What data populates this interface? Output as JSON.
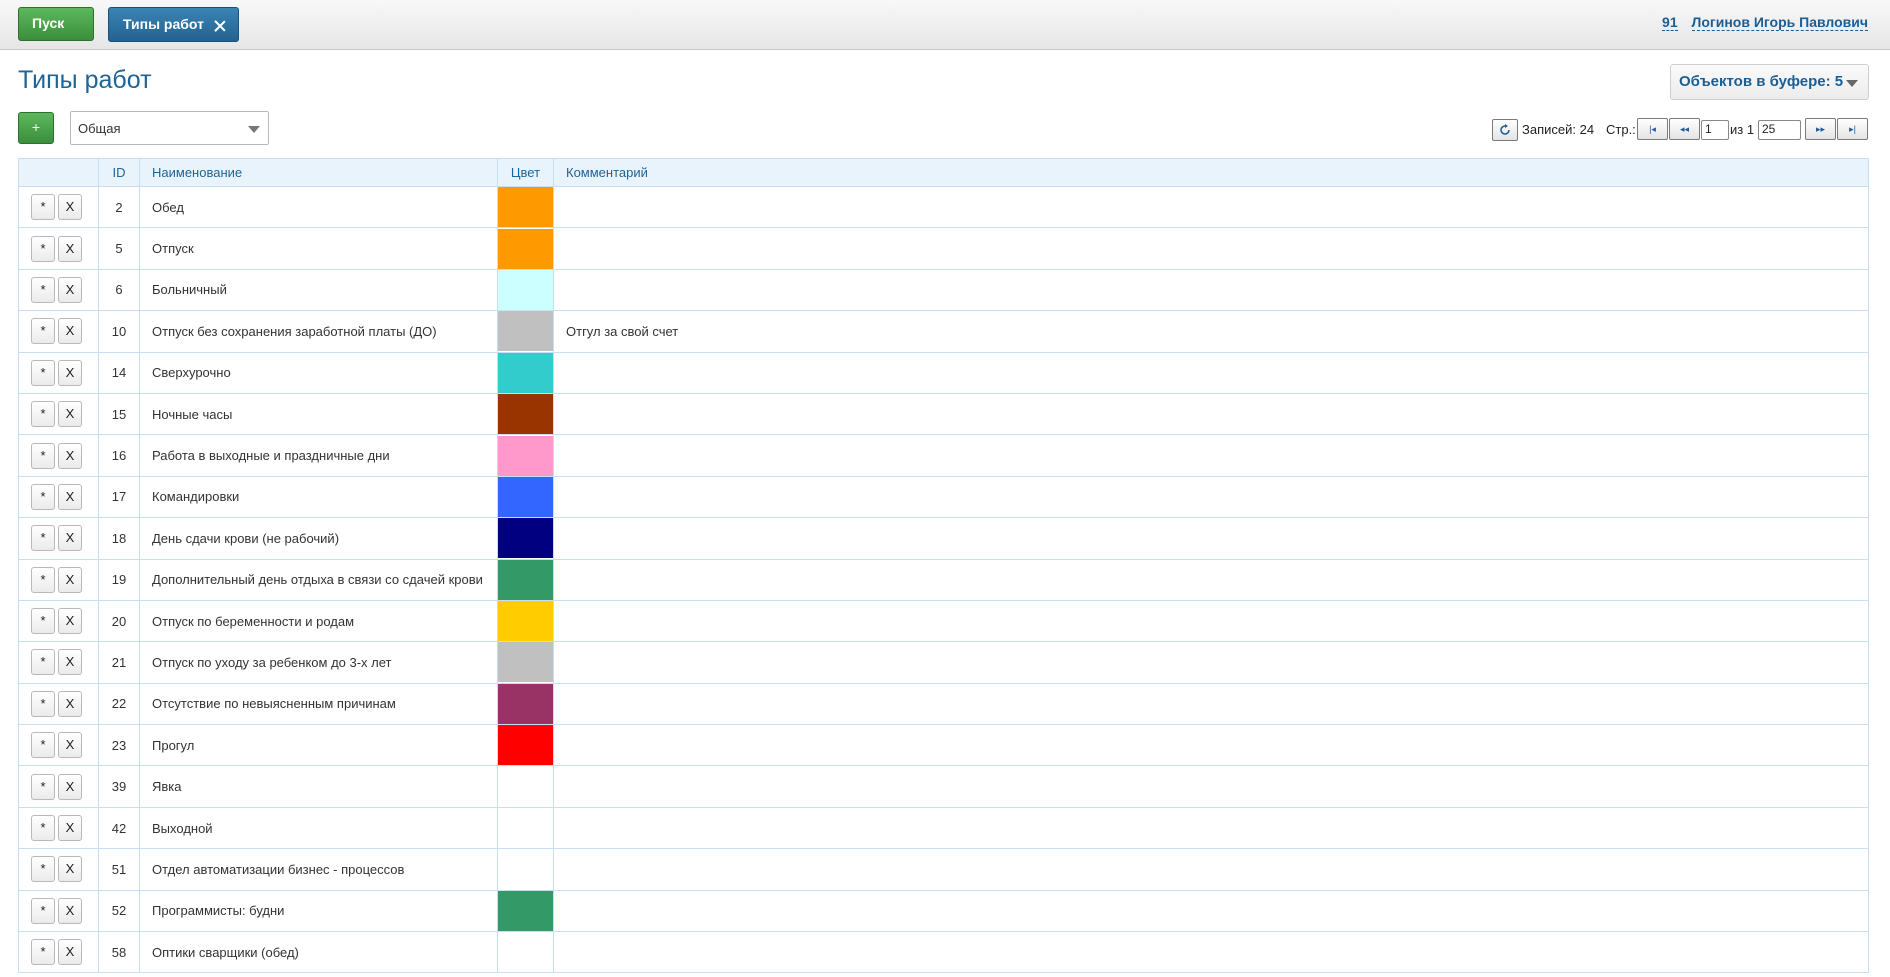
{
  "topbar": {
    "start_label": "Пуск",
    "tab_label": "Типы работ",
    "user_id": "91",
    "user_name": "Логинов Игорь Павлович"
  },
  "page": {
    "title": "Типы работ",
    "buffer_label": "Объектов в буфере: 5"
  },
  "toolbar": {
    "add_label": "+",
    "filter_value": "Общая"
  },
  "pager": {
    "records_label": "Записей: 24",
    "page_label": "Стр.:",
    "page_value": "1",
    "of_label": "из 1",
    "page_size": "25"
  },
  "table": {
    "columns": [
      "",
      "ID",
      "Наименование",
      "Цвет",
      "Комментарий"
    ],
    "edit_label": "*",
    "delete_label": "X",
    "rows": [
      {
        "id": "2",
        "name": "Обед",
        "color": "#ff9900",
        "comment": ""
      },
      {
        "id": "5",
        "name": "Отпуск",
        "color": "#ff9900",
        "comment": ""
      },
      {
        "id": "6",
        "name": "Больничный",
        "color": "#ccffff",
        "comment": ""
      },
      {
        "id": "10",
        "name": "Отпуск без сохранения заработной платы (ДО)",
        "color": "#c0c0c0",
        "comment": "Отгул за свой счет"
      },
      {
        "id": "14",
        "name": "Сверхурочно",
        "color": "#33cccc",
        "comment": ""
      },
      {
        "id": "15",
        "name": "Ночные часы",
        "color": "#993300",
        "comment": ""
      },
      {
        "id": "16",
        "name": "Работа в выходные и праздничные дни",
        "color": "#ff99cc",
        "comment": ""
      },
      {
        "id": "17",
        "name": "Командировки",
        "color": "#3366ff",
        "comment": ""
      },
      {
        "id": "18",
        "name": "День сдачи крови (не рабочий)",
        "color": "#000080",
        "comment": ""
      },
      {
        "id": "19",
        "name": "Дополнительный день отдыха в связи со сдачей крови",
        "color": "#339966",
        "comment": ""
      },
      {
        "id": "20",
        "name": "Отпуск по беременности и родам",
        "color": "#ffcc00",
        "comment": ""
      },
      {
        "id": "21",
        "name": "Отпуск по уходу за ребенком до 3-х лет",
        "color": "#c0c0c0",
        "comment": ""
      },
      {
        "id": "22",
        "name": "Отсутствие по невыясненным причинам",
        "color": "#993366",
        "comment": ""
      },
      {
        "id": "23",
        "name": "Прогул",
        "color": "#ff0000",
        "comment": ""
      },
      {
        "id": "39",
        "name": "Явка",
        "color": "",
        "comment": ""
      },
      {
        "id": "42",
        "name": "Выходной",
        "color": "",
        "comment": ""
      },
      {
        "id": "51",
        "name": "Отдел автоматизации бизнес - процессов",
        "color": "",
        "comment": ""
      },
      {
        "id": "52",
        "name": "Программисты: будни",
        "color": "#339966",
        "comment": ""
      },
      {
        "id": "58",
        "name": "Оптики сварщики (обед)",
        "color": "",
        "comment": ""
      }
    ]
  }
}
